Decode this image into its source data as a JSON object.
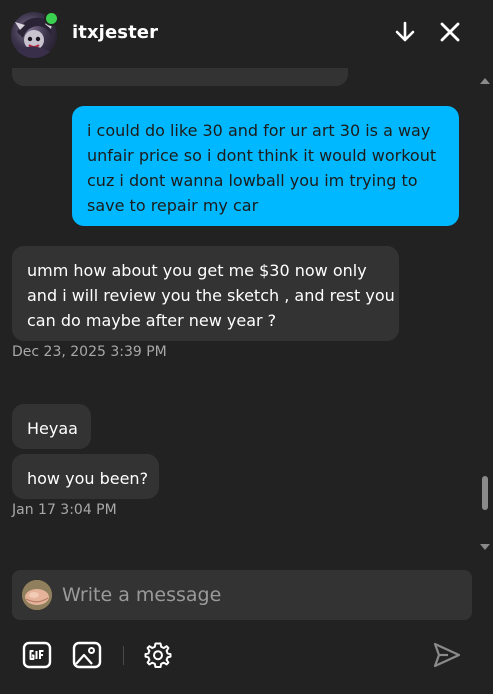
{
  "header": {
    "username": "itxjester",
    "online": true,
    "icons": {
      "minimize": "arrow-down-icon",
      "close": "close-icon"
    }
  },
  "messages": [
    {
      "direction": "outgoing",
      "lines": [
        "i could do like 30 and for ur art 30 is a way",
        "unfair price so i dont think it would workout",
        "cuz i dont wanna lowball you im trying to",
        "save to repair my car"
      ]
    },
    {
      "direction": "incoming",
      "lines": [
        "umm how about you get me $30 now only",
        "and i will review you the sketch , and rest you",
        "can do maybe after new year ?"
      ]
    },
    {
      "direction": "incoming",
      "lines": [
        "Heyaa"
      ]
    },
    {
      "direction": "incoming",
      "lines": [
        "how you been?"
      ]
    }
  ],
  "timestamps": [
    "Dec 23, 2025 3:39 PM",
    "Jan 17 3:04 PM"
  ],
  "composer": {
    "placeholder": "Write a message"
  },
  "toolbar": {
    "icons": [
      "gif-icon",
      "image-icon",
      "settings-icon",
      "send-icon"
    ]
  },
  "colors": {
    "background": "#222222",
    "bubble_in": "#333333",
    "bubble_out": "#00b8ff",
    "online": "#3bd150",
    "timestamp": "#a8a8a8"
  }
}
